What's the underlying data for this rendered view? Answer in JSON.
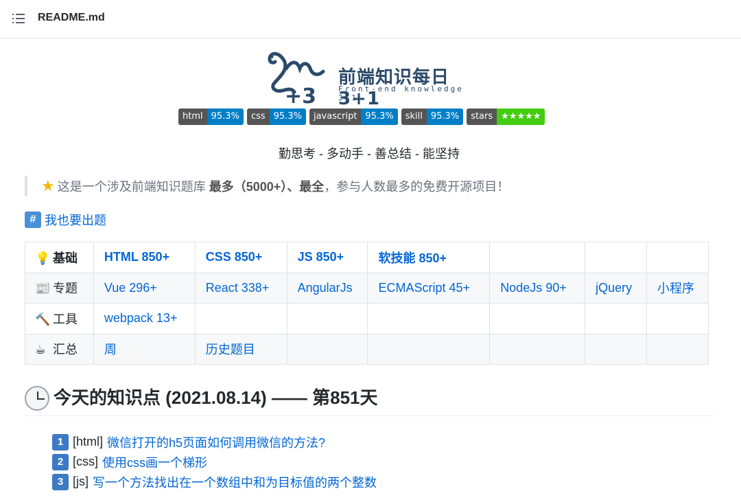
{
  "header": {
    "file_name": "README.md",
    "toc_icon": "list-icon"
  },
  "logo": {
    "title": "前端知识每日3+1",
    "subtitle": "Front-end knowledge 3+1",
    "image_icon": "camel-logo-icon"
  },
  "badges": [
    {
      "label": "html",
      "value": "95.3%",
      "color": "#007ec6"
    },
    {
      "label": "css",
      "value": "95.3%",
      "color": "#007ec6"
    },
    {
      "label": "javascript",
      "value": "95.3%",
      "color": "#007ec6"
    },
    {
      "label": "skill",
      "value": "95.3%",
      "color": "#007ec6"
    },
    {
      "label": "stars",
      "value": "★★★★★",
      "color": "#44cc11"
    }
  ],
  "motto": "勤思考 - 多动手 - 善总结 - 能坚持",
  "quote": {
    "icon": "star-icon",
    "prefix": "这是一个涉及前端知识题库",
    "bold1": "最多（5000+）、最全",
    "suffix": "，参与人数最多的免费开源项目！"
  },
  "contribute": {
    "icon": "hash-icon",
    "label": "我也要出题"
  },
  "table": {
    "rows": [
      {
        "icon": "💡",
        "icon_name": "lightbulb-icon",
        "category": "基础",
        "bold": true,
        "cells": [
          "HTML 850+",
          "CSS 850+",
          "JS 850+",
          "软技能 850+",
          "",
          "",
          ""
        ]
      },
      {
        "icon": "📰",
        "icon_name": "newspaper-icon",
        "category": "专题",
        "bold": false,
        "cells": [
          "Vue 296+",
          "React 338+",
          "AngularJs",
          "ECMAScript 45+",
          "NodeJs 90+",
          "jQuery",
          "小程序"
        ]
      },
      {
        "icon": "🔨",
        "icon_name": "hammer-icon",
        "category": "工具",
        "bold": false,
        "cells": [
          "webpack 13+",
          "",
          "",
          "",
          "",
          "",
          ""
        ]
      },
      {
        "icon": "☕",
        "icon_name": "coffee-icon",
        "category": "汇总",
        "bold": false,
        "cells": [
          "周",
          "历史题目",
          "",
          "",
          "",
          "",
          ""
        ]
      }
    ]
  },
  "today": {
    "icon": "clock-icon",
    "title": "今天的知识点 (2021.08.14) —— 第851天",
    "items": [
      {
        "num": "1",
        "tag": "[html]",
        "text": "微信打开的h5页面如何调用微信的方法?"
      },
      {
        "num": "2",
        "tag": "[css]",
        "text": "使用css画一个梯形"
      },
      {
        "num": "3",
        "tag": "[js]",
        "text": "写一个方法找出在一个数组中和为目标值的两个整数"
      }
    ]
  }
}
